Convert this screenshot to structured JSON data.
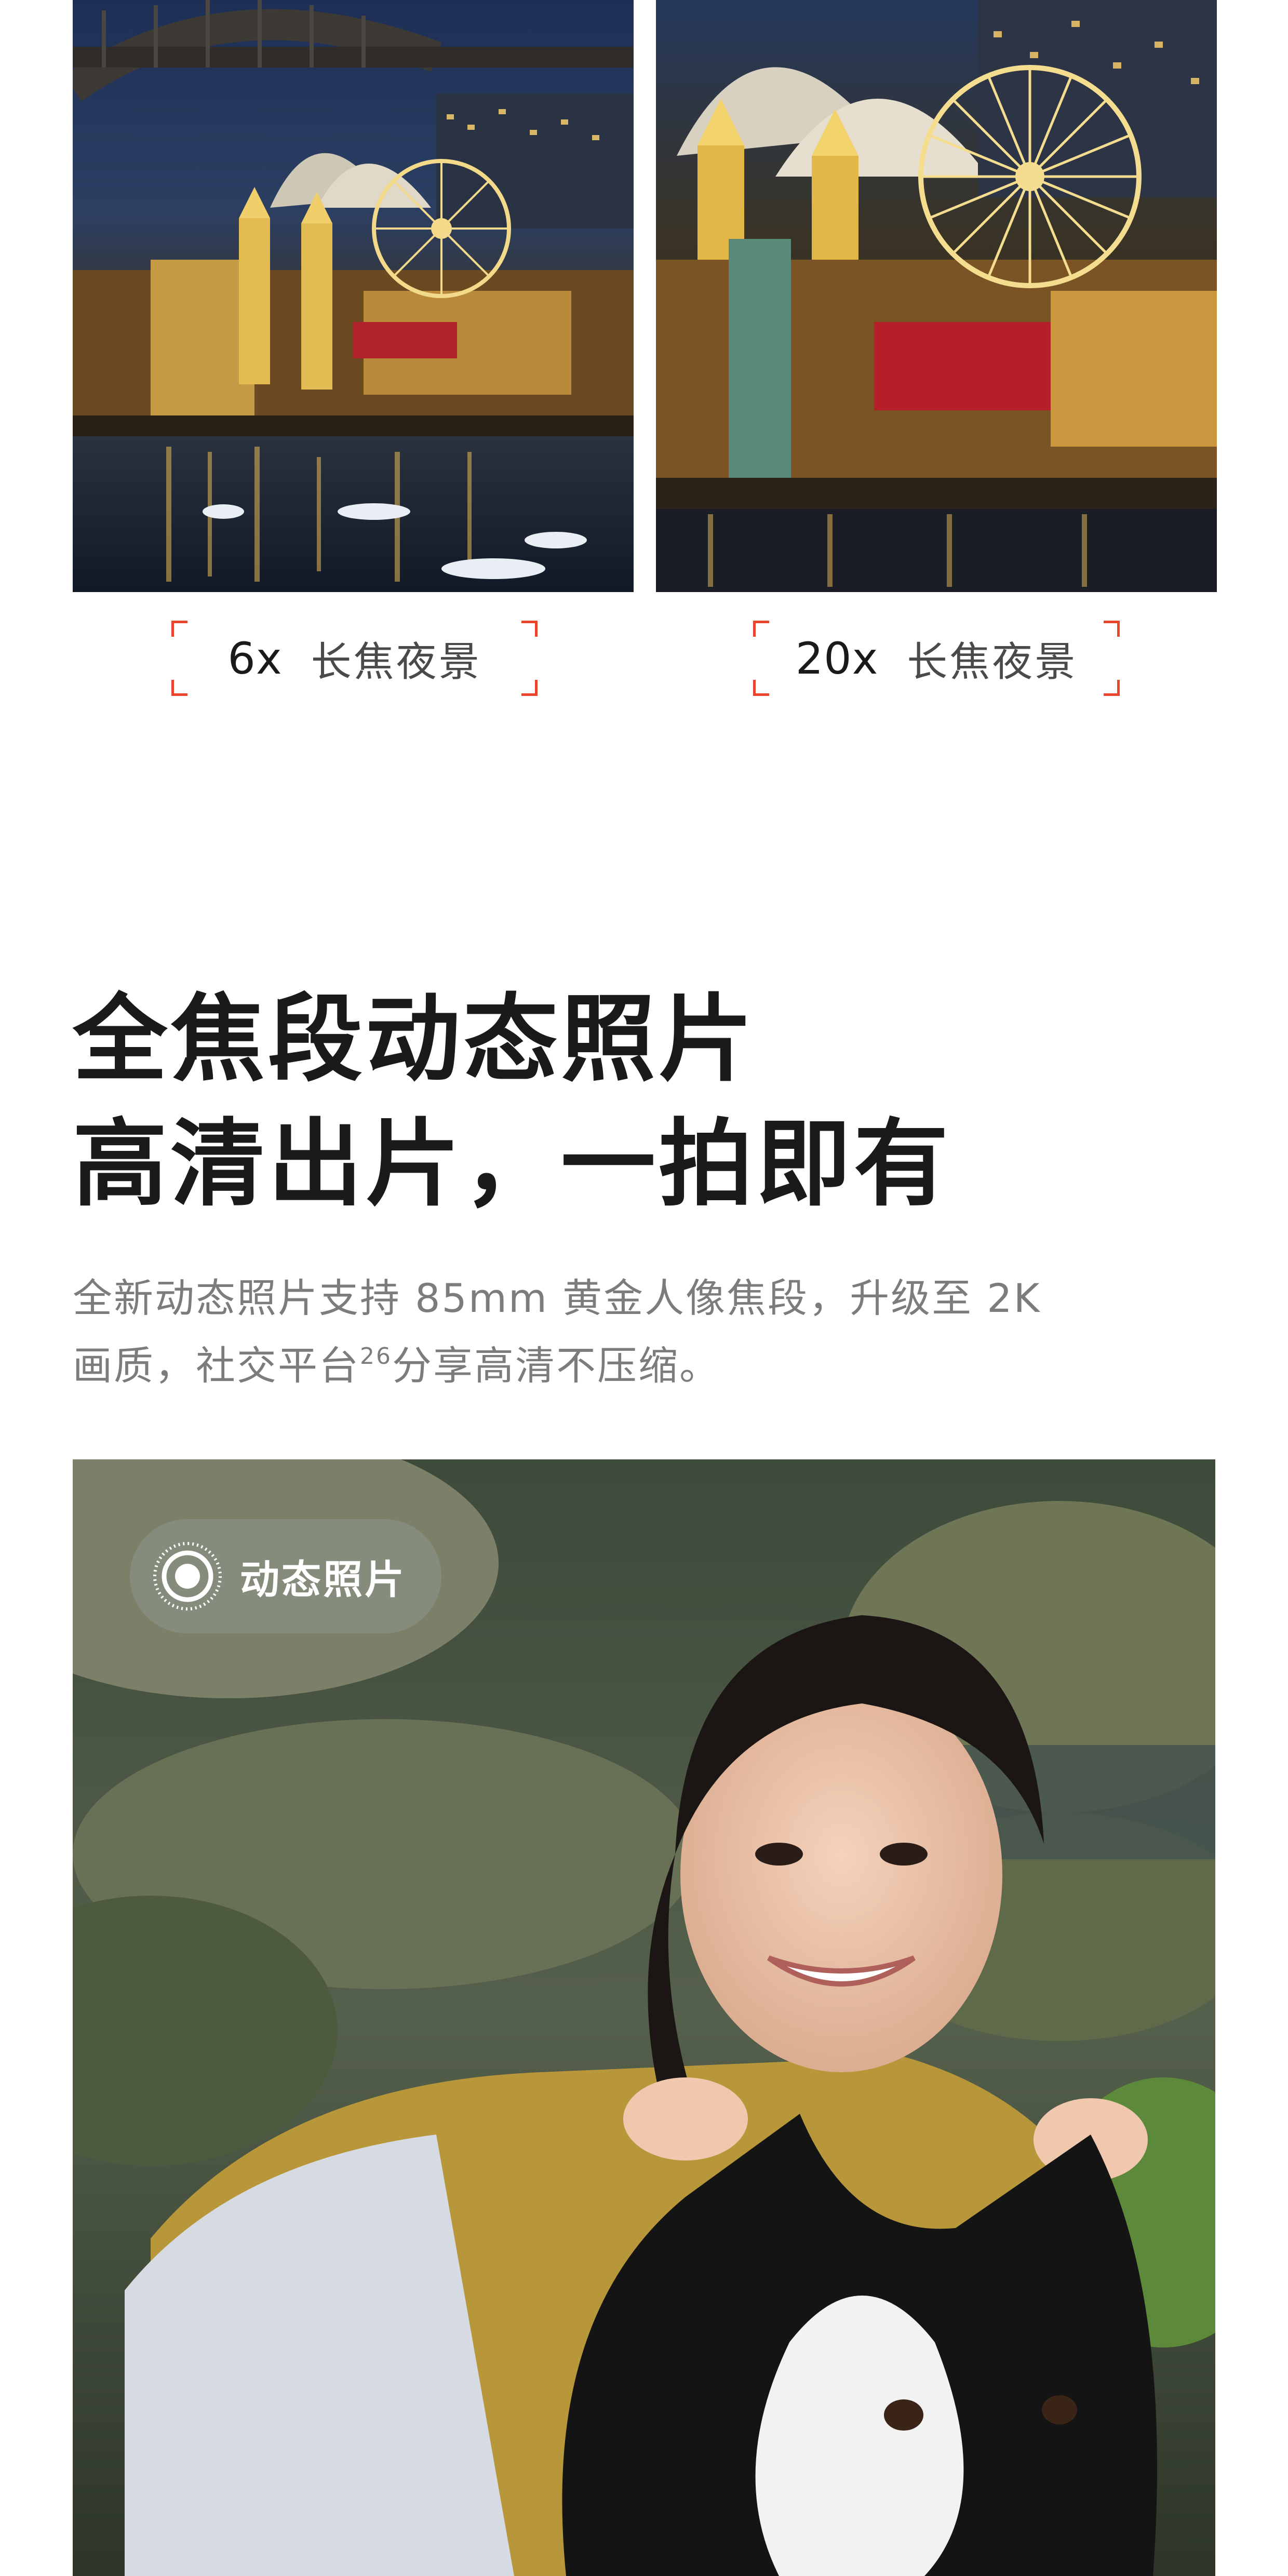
{
  "comparison": {
    "items": [
      {
        "zoom": "6x",
        "label": "长焦夜景"
      },
      {
        "zoom": "20x",
        "label": "长焦夜景"
      }
    ],
    "bracket_color": "#e8452c"
  },
  "feature": {
    "headline_line_1": "全焦段动态照片",
    "headline_line_2": "高清出片，一拍即有",
    "body_line_1": "全新动态照片支持 85mm 黄金人像焦段，升级至 2K",
    "body_line_2_before": "画质，社交平台",
    "body_line_2_footnote": "26",
    "body_line_2_after": "分享高清不压缩。"
  },
  "hero": {
    "badge_label": "动态照片",
    "badge_icon": "live-photo-icon"
  }
}
